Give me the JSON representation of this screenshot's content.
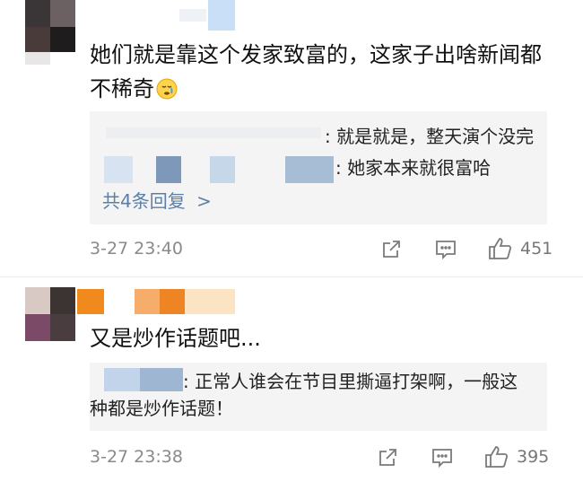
{
  "comments": [
    {
      "text": "她们就是靠这个发家致富的，这家子出啥新闻都不稀奇",
      "emoji_icon": "pensive-sad-emoji-icon",
      "replies": [
        {
          "text": ": 就是就是，整天演个没完"
        },
        {
          "text": ": 她家本来就很富哈"
        }
      ],
      "more_replies": "共4条回复",
      "more_chevron": ">",
      "time": "3-27 23:40",
      "likes": "451"
    },
    {
      "text": "又是炒作话题吧...",
      "replies": [
        {
          "text": ": 正常人谁会在节目里撕逼打架啊，一般这种都是炒作话题！"
        }
      ],
      "time": "3-27 23:38",
      "likes": "395"
    }
  ],
  "colors": {
    "link": "#5c7fa8",
    "reply_bg": "#f4f4f4",
    "meta": "#8a8a8a"
  }
}
